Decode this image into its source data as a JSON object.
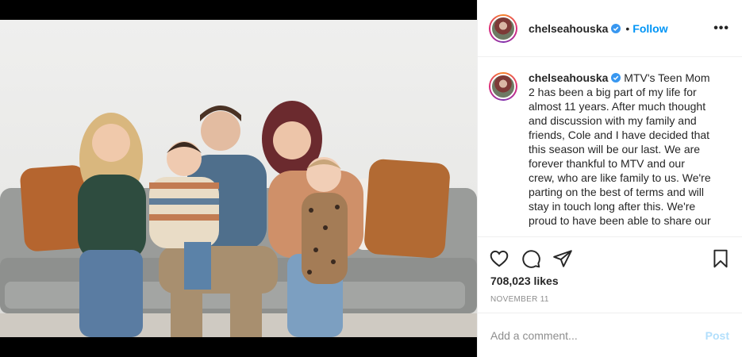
{
  "post": {
    "username": "chelseahouska",
    "follow_label": "Follow",
    "separator": "•",
    "more_label": "•••",
    "caption_text": "MTV's Teen Mom 2 has been a big part of my life for almost 11 years. After much thought and discussion with my family and friends, Cole and I have decided that this season will be our last. We are forever thankful to MTV and our crew, who are like family to us. We're parting on the best of terms and will stay in touch long after this. We're proud to have been able to share our",
    "likes": "708,023 likes",
    "date": "NOVEMBER 11",
    "comment_placeholder": "Add a comment...",
    "post_label": "Post"
  },
  "icons": {
    "like": "heart-icon",
    "comment": "comment-icon",
    "share": "send-icon",
    "save": "bookmark-icon",
    "verified": "verified-badge-icon",
    "more": "more-options-icon"
  },
  "colors": {
    "accent": "#0095f6",
    "post_disabled": "#b2dffc",
    "muted": "#8e8e8e",
    "text": "#262626"
  }
}
